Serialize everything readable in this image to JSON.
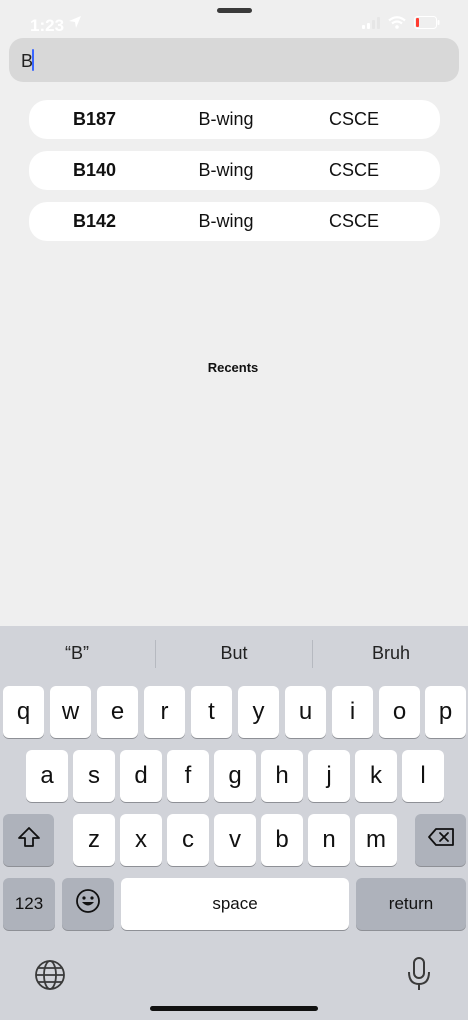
{
  "status": {
    "time": "1:23"
  },
  "search": {
    "value": "B"
  },
  "results": [
    {
      "room": "B187",
      "wing": "B-wing",
      "dept": "CSCE"
    },
    {
      "room": "B140",
      "wing": "B-wing",
      "dept": "CSCE"
    },
    {
      "room": "B142",
      "wing": "B-wing",
      "dept": "CSCE"
    }
  ],
  "recents_label": "Recents",
  "keyboard": {
    "suggestions": [
      "“B”",
      "But",
      "Bruh"
    ],
    "row1": [
      "q",
      "w",
      "e",
      "r",
      "t",
      "y",
      "u",
      "i",
      "o",
      "p"
    ],
    "row2": [
      "a",
      "s",
      "d",
      "f",
      "g",
      "h",
      "j",
      "k",
      "l"
    ],
    "row3": [
      "z",
      "x",
      "c",
      "v",
      "b",
      "n",
      "m"
    ],
    "numbers_key": "123",
    "space_key": "space",
    "return_key": "return"
  },
  "icons": {
    "location": "location-arrow-icon",
    "signal": "signal-icon",
    "wifi": "wifi-icon",
    "battery": "battery-icon",
    "shift": "shift-icon",
    "delete": "delete-icon",
    "emoji": "emoji-icon",
    "globe": "globe-icon",
    "mic": "microphone-icon"
  },
  "colors": {
    "caret": "#3a66ff",
    "battery_low": "#ff3b30",
    "keyboard_bg": "#d1d3d9"
  }
}
